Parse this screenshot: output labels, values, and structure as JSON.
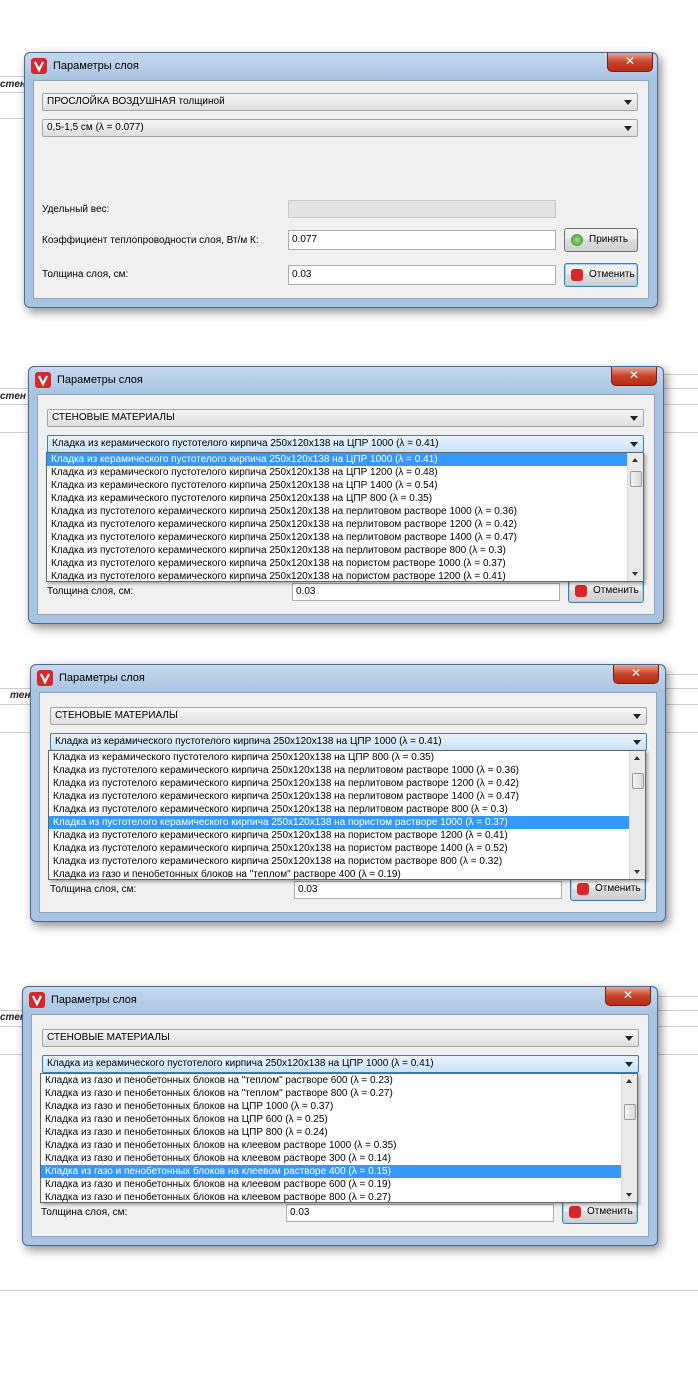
{
  "background": {
    "fragment_text": "стен",
    "fragment_text_2": "тен"
  },
  "window_title": "Параметры слоя",
  "close_glyph": "✕",
  "dialog1": {
    "category": "ПРОСЛОЙКА ВОЗДУШНАЯ толщиной",
    "material": "0,5-1,5 см (λ = 0.077)",
    "weight_label": "Удельный вес:",
    "weight_value": "",
    "conductivity_label": "Коэффициент теплопроводности слоя, Вт/м К:",
    "conductivity_value": "0.077",
    "thickness_label": "Толщина слоя, см:",
    "thickness_value": "0.03",
    "accept_label": "Принять",
    "cancel_label": "Отменить"
  },
  "dialog2": {
    "category": "СТЕНОВЫЕ МАТЕРИАЛЫ",
    "material": "Кладка из  керамического пустотелого  кирпича 250x120x138 на ЦПР 1000 (λ = 0.41)",
    "thickness_label": "Толщина слоя, см:",
    "thickness_value": "0.03",
    "cancel_label": "Отменить",
    "options": [
      "Кладка из  керамического пустотелого  кирпича 250x120x138 на ЦПР 1000 (λ = 0.41)",
      "Кладка из  керамического пустотелого  кирпича 250x120x138 на ЦПР 1200 (λ = 0.48)",
      "Кладка из  керамического пустотелого  кирпича 250x120x138 на ЦПР 1400 (λ = 0.54)",
      "Кладка из  керамического пустотелого  кирпича 250x120x138 на ЦПР 800 (λ = 0.35)",
      "Кладка из  пустотелого керамического кирпича 250x120x138 на перлитовом растворе 1000 (λ = 0.36)",
      "Кладка из  пустотелого керамического кирпича 250x120x138 на перлитовом растворе 1200 (λ = 0.42)",
      "Кладка из  пустотелого керамического кирпича 250x120x138 на перлитовом растворе 1400 (λ = 0.47)",
      "Кладка из  пустотелого керамического кирпича 250x120x138 на перлитовом растворе 800 (λ = 0.3)",
      "Кладка из  пустотелого керамического кирпича 250x120x138 на пористом растворе 1000 (λ = 0.37)",
      "Кладка из  пустотелого керамического кирпича 250x120x138 на пористом растворе 1200 (λ = 0.41)"
    ],
    "selected_index": 0
  },
  "dialog3": {
    "category": "СТЕНОВЫЕ МАТЕРИАЛЫ",
    "material": "Кладка из  керамического пустотелого  кирпича 250x120x138 на ЦПР 1000 (λ = 0.41)",
    "thickness_label": "Толщина слоя, см:",
    "thickness_value": "0.03",
    "cancel_label": "Отменить",
    "options": [
      "Кладка из  керамического пустотелого  кирпича 250x120x138 на ЦПР 800 (λ = 0.35)",
      "Кладка из  пустотелого керамического кирпича 250x120x138 на перлитовом растворе 1000 (λ = 0.36)",
      "Кладка из  пустотелого керамического кирпича 250x120x138 на перлитовом растворе 1200 (λ = 0.42)",
      "Кладка из  пустотелого керамического кирпича 250x120x138 на перлитовом растворе 1400 (λ = 0.47)",
      "Кладка из  пустотелого керамического кирпича 250x120x138 на перлитовом растворе 800 (λ = 0.3)",
      "Кладка из  пустотелого керамического кирпича 250x120x138 на пористом растворе 1000 (λ = 0.37)",
      "Кладка из  пустотелого керамического кирпича 250x120x138 на пористом растворе 1200 (λ = 0.41)",
      "Кладка из  пустотелого керамического кирпича 250x120x138 на пористом растворе 1400 (λ = 0.52)",
      "Кладка из  пустотелого керамического кирпича 250x120x138 на пористом растворе 800 (λ = 0.32)",
      "Кладка из газо и пенобетонных блоков на \"теплом\" растворе 400 (λ = 0.19)"
    ],
    "selected_index": 5
  },
  "dialog4": {
    "category": "СТЕНОВЫЕ МАТЕРИАЛЫ",
    "material": "Кладка из  керамического пустотелого  кирпича 250x120x138 на ЦПР 1000 (λ = 0.41)",
    "thickness_label": "Толщина слоя, см:",
    "thickness_value": "0.03",
    "cancel_label": "Отменить",
    "options": [
      "Кладка из газо и пенобетонных блоков на \"теплом\" растворе 600 (λ = 0.23)",
      "Кладка из газо и пенобетонных блоков на \"теплом\" растворе 800 (λ = 0.27)",
      "Кладка из газо и пенобетонных блоков на ЦПР 1000 (λ = 0.37)",
      "Кладка из газо и пенобетонных блоков на ЦПР 600 (λ = 0.25)",
      "Кладка из газо и пенобетонных блоков на ЦПР 800 (λ = 0.24)",
      "Кладка из газо и пенобетонных блоков на клеевом растворе 1000 (λ = 0.35)",
      "Кладка из газо и пенобетонных блоков на клеевом растворе 300 (λ = 0.14)",
      "Кладка из газо и пенобетонных блоков на клеевом растворе 400 (λ = 0.15)",
      "Кладка из газо и пенобетонных блоков на клеевом растворе 600 (λ = 0.19)",
      "Кладка из газо и пенобетонных блоков на клеевом растворе 800 (λ = 0.27)"
    ],
    "selected_index": 7
  },
  "colors": {
    "selection": "#3399ff",
    "window_frame": "#a9c4e2",
    "close_button": "#c7432a",
    "logo": "#d9262b"
  }
}
